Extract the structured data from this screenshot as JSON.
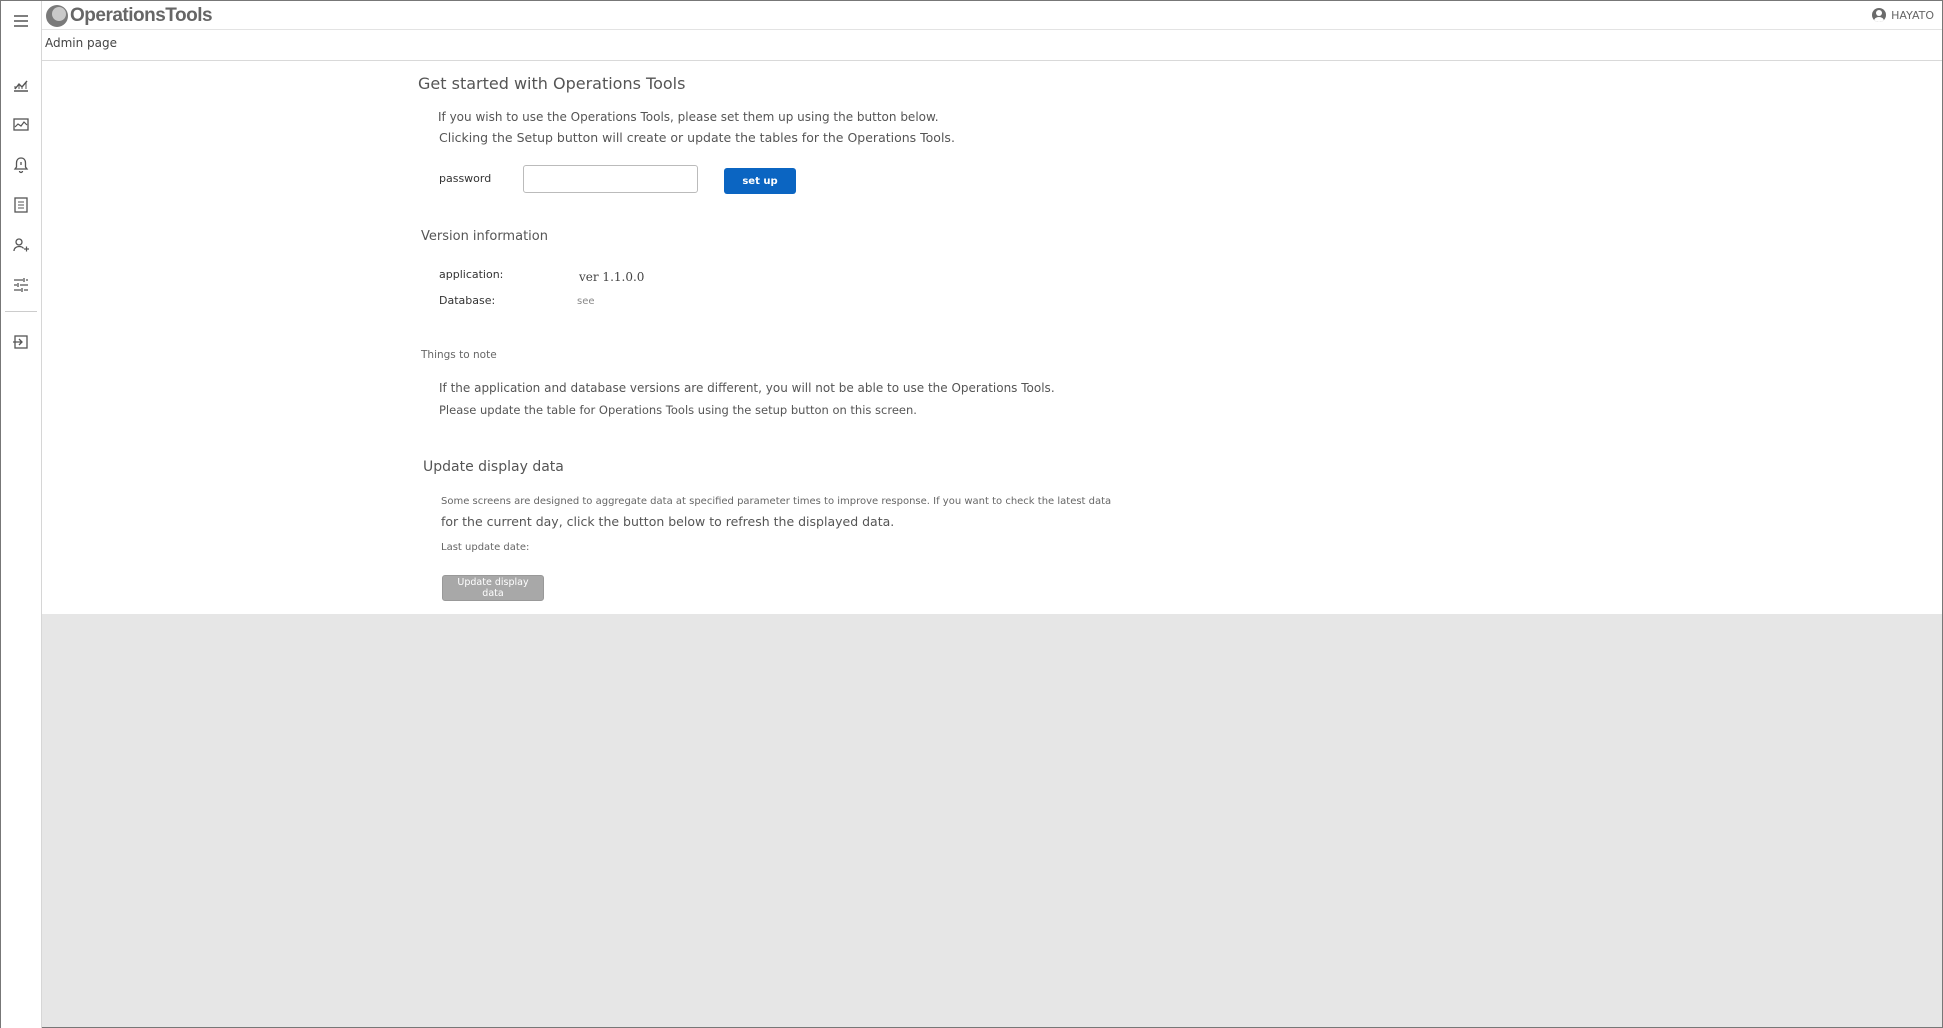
{
  "app": {
    "logo_text": "OperationsTools",
    "user_name": "HAYATO"
  },
  "breadcrumb": {
    "current": "Admin page"
  },
  "sidebar": {
    "items": [
      {
        "name": "menu",
        "icon": "hamburger-menu-icon"
      },
      {
        "name": "analytics",
        "icon": "line-chart-icon"
      },
      {
        "name": "monitor",
        "icon": "monitor-chart-icon"
      },
      {
        "name": "alerts",
        "icon": "bell-alert-icon"
      },
      {
        "name": "reports",
        "icon": "list-document-icon"
      },
      {
        "name": "users",
        "icon": "user-settings-icon"
      },
      {
        "name": "settings",
        "icon": "tune-sliders-icon"
      },
      {
        "name": "logout",
        "icon": "logout-icon"
      }
    ]
  },
  "setup": {
    "title": "Get started with Operations Tools",
    "line1": "If you wish to use the Operations Tools, please set them up using the button below.",
    "line2": "Clicking the Setup button will create or update the tables for the Operations Tools.",
    "password_label": "password",
    "password_value": "",
    "button_label": "set up"
  },
  "version": {
    "title": "Version information",
    "application_label": "application:",
    "application_value": "ver 1.1.0.0",
    "database_label": "Database:",
    "database_value": "see"
  },
  "notes": {
    "title": "Things to note",
    "line1": "If the application and database versions are different, you will not be able to use the Operations Tools.",
    "line2": "Please update the table for Operations Tools using the setup button on this screen."
  },
  "update": {
    "title": "Update display data",
    "line1": "Some screens are designed to aggregate data at specified parameter times to improve response. If you want to check the latest data",
    "line2": "for the current day, click the button below to refresh the displayed data.",
    "last_update_label": "Last update date:",
    "button_label": "Update display data"
  },
  "colors": {
    "primary_button": "#0b65c2",
    "disabled_button": "#a8a8a8",
    "background": "#e6e6e6"
  }
}
